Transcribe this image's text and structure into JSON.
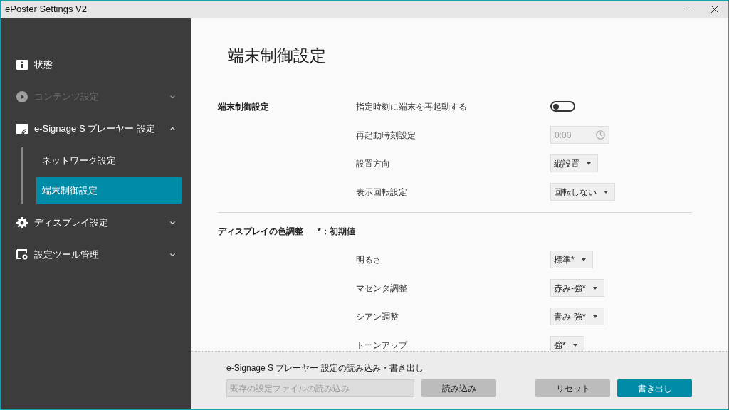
{
  "window": {
    "title": "ePoster Settings V2"
  },
  "sidebar": {
    "items": [
      {
        "label": "状態",
        "disabled": false,
        "selected": false
      },
      {
        "label": "コンテンツ設定",
        "disabled": true,
        "selected": false,
        "expanded": false
      },
      {
        "label": "e-Signage S プレーヤー 設定",
        "disabled": false,
        "selected": false,
        "expanded": true,
        "children": [
          {
            "label": "ネットワーク設定",
            "selected": false
          },
          {
            "label": "端末制御設定",
            "selected": true
          }
        ]
      },
      {
        "label": "ディスプレイ設定",
        "disabled": false,
        "selected": false,
        "expanded": false
      },
      {
        "label": "設定ツール管理",
        "disabled": false,
        "selected": false,
        "expanded": false
      }
    ]
  },
  "page": {
    "title": "端末制御設定",
    "sections": [
      {
        "label": "端末制御設定",
        "rows": [
          {
            "kind": "toggle",
            "label": "指定時刻に端末を再起動する",
            "on": false
          },
          {
            "kind": "time",
            "label": "再起動時刻設定",
            "value": "0:00",
            "disabled": true
          },
          {
            "kind": "select",
            "label": "設置方向",
            "value": "縦設置"
          },
          {
            "kind": "select",
            "label": "表示回転設定",
            "value": "回転しない"
          }
        ]
      },
      {
        "label": "ディスプレイの色調整",
        "note": "*：初期値",
        "rows": [
          {
            "kind": "select",
            "label": "明るさ",
            "value": "標準*"
          },
          {
            "kind": "select",
            "label": "マゼンタ調整",
            "value": "赤み-強*"
          },
          {
            "kind": "select",
            "label": "シアン調整",
            "value": "青み-強*"
          },
          {
            "kind": "select",
            "label": "トーンアップ",
            "value": "強*"
          }
        ]
      }
    ]
  },
  "footer": {
    "title": "e-Signage S プレーヤー 設定の読み込み・書き出し",
    "file_field": {
      "placeholder": "既存の設定ファイルの読み込み"
    },
    "buttons": [
      {
        "label": "読み込み",
        "kind": "secondary"
      },
      {
        "label": "リセット",
        "kind": "secondary"
      },
      {
        "label": "書き出し",
        "kind": "primary"
      }
    ]
  }
}
